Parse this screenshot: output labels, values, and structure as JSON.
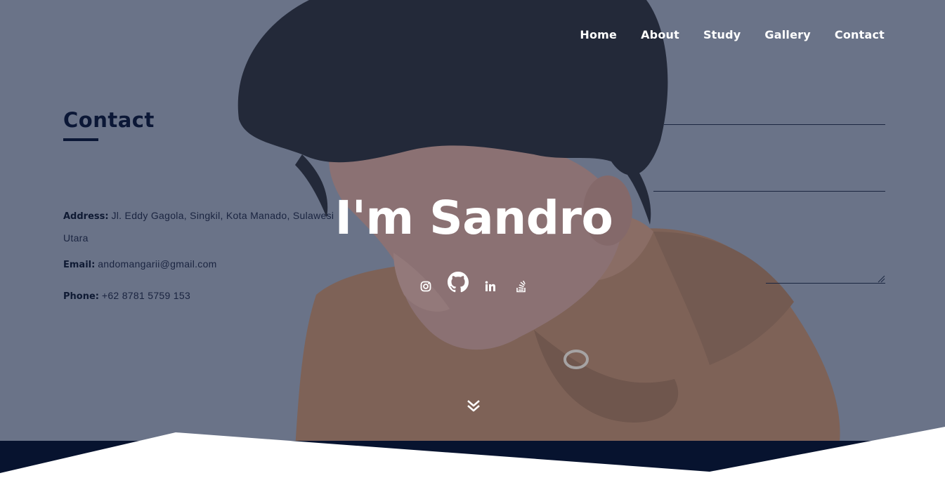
{
  "nav": {
    "items": [
      "Home",
      "About",
      "Study",
      "Gallery",
      "Contact"
    ]
  },
  "contact": {
    "title": "Contact",
    "address_label": "Address:",
    "address_value": "Jl. Eddy Gagola, Singkil, Kota Manado, Sulawesi Utara",
    "email_label": "Email:",
    "email_value": "andomangarii@gmail.com",
    "phone_label": "Phone:",
    "phone_value": "+62 8781 5759 153"
  },
  "hero": {
    "title": "I'm Sandro",
    "social_icons": [
      "instagram-icon",
      "github-icon",
      "linkedin-icon",
      "stackoverflow-icon"
    ],
    "scroll_icon": "double-chevron-down-icon"
  },
  "colors": {
    "overlay": "#6a7388",
    "navy": "#0b1736",
    "footer": "#07132f",
    "white": "#ffffff",
    "hoodie": "#7e6257"
  }
}
